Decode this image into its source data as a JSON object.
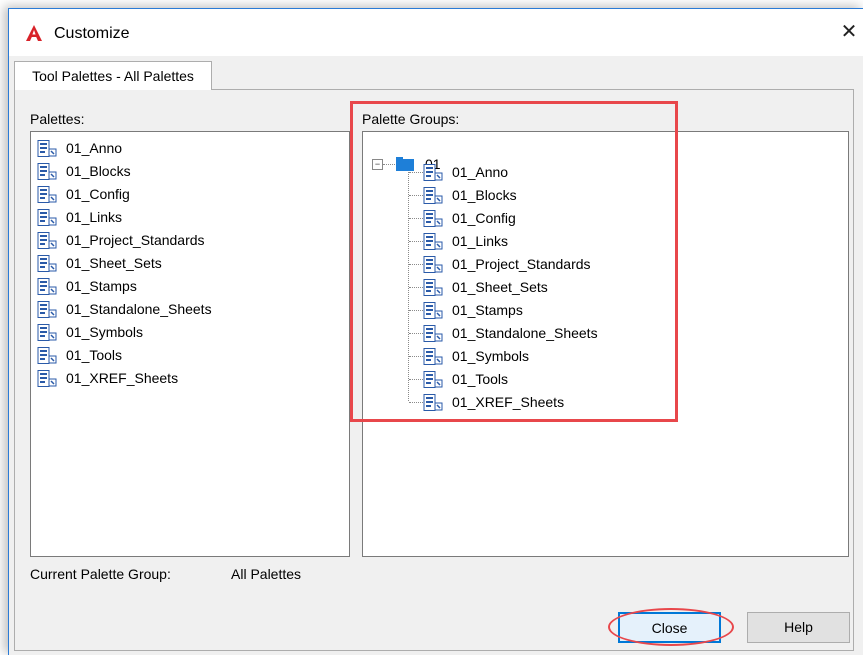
{
  "window": {
    "title": "Customize",
    "close_glyph": "✕",
    "accent_color": "#2b7bd6"
  },
  "tab": {
    "label": "Tool Palettes - All Palettes"
  },
  "palettes": {
    "label": "Palettes:",
    "items": [
      "01_Anno",
      "01_Blocks",
      "01_Config",
      "01_Links",
      "01_Project_Standards",
      "01_Sheet_Sets",
      "01_Stamps",
      "01_Standalone_Sheets",
      "01_Symbols",
      "01_Tools",
      "01_XREF_Sheets"
    ]
  },
  "palette_groups": {
    "label": "Palette Groups:",
    "root": {
      "label": "01",
      "expander": "−"
    },
    "items": [
      "01_Anno",
      "01_Blocks",
      "01_Config",
      "01_Links",
      "01_Project_Standards",
      "01_Sheet_Sets",
      "01_Stamps",
      "01_Standalone_Sheets",
      "01_Symbols",
      "01_Tools",
      "01_XREF_Sheets"
    ]
  },
  "current_group": {
    "label": "Current Palette Group:",
    "value": "All Palettes"
  },
  "buttons": {
    "close": "Close",
    "help": "Help"
  },
  "annotation_color": "#e8474b"
}
